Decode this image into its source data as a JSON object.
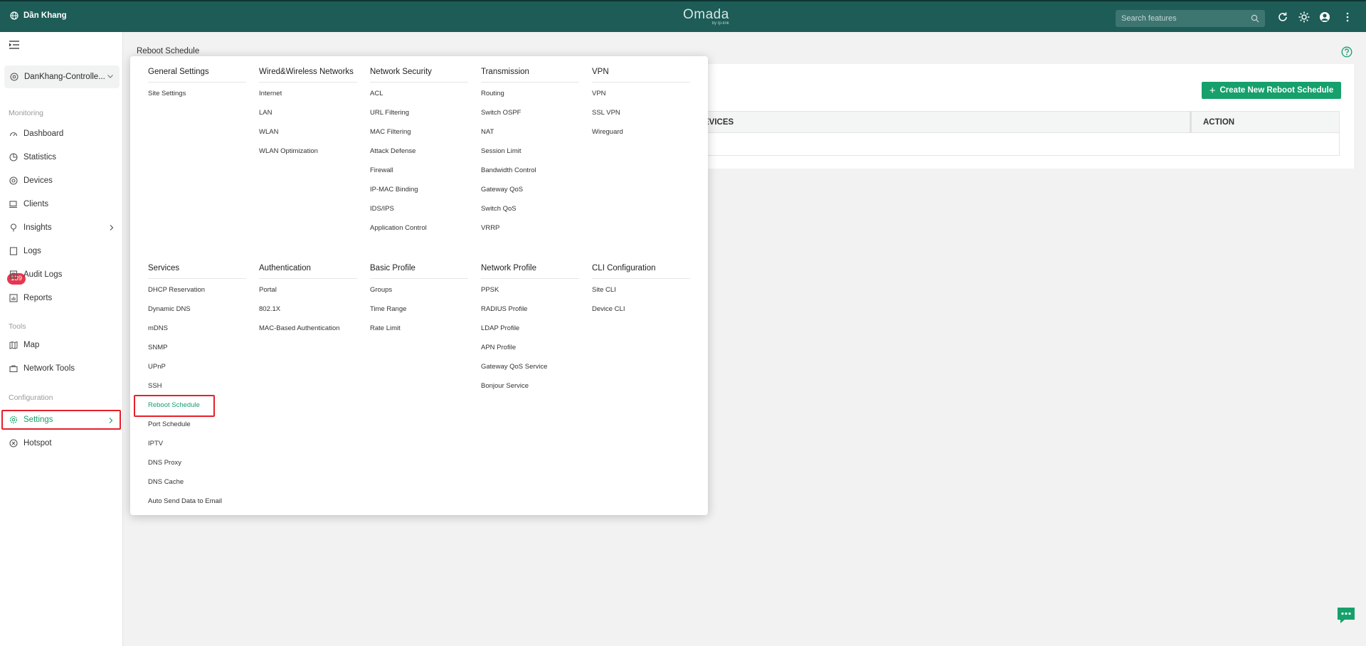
{
  "topbar": {
    "site_name": "Dần Khang",
    "logo_text": "Omada",
    "logo_sub": "by tp-link",
    "search_placeholder": "Search features"
  },
  "sidebar": {
    "site_select": "DanKhang-Controlle...",
    "sections": {
      "monitoring": "Monitoring",
      "tools": "Tools",
      "configuration": "Configuration"
    },
    "items": {
      "dashboard": "Dashboard",
      "statistics": "Statistics",
      "devices": "Devices",
      "clients": "Clients",
      "insights": "Insights",
      "logs": "Logs",
      "logs_badge": "139",
      "audit_logs": "Audit Logs",
      "reports": "Reports",
      "map": "Map",
      "network_tools": "Network Tools",
      "settings": "Settings",
      "hotspot": "Hotspot"
    }
  },
  "main": {
    "breadcrumb": "Reboot Schedule",
    "create_button": "Create New Reboot Schedule",
    "table_headers": [
      "EVICES",
      "ACTION"
    ]
  },
  "menu": {
    "columns_top": [
      {
        "title": "General Settings",
        "items": [
          "Site Settings"
        ]
      },
      {
        "title": "Wired&Wireless Networks",
        "items": [
          "Internet",
          "LAN",
          "WLAN",
          "WLAN Optimization"
        ]
      },
      {
        "title": "Network Security",
        "items": [
          "ACL",
          "URL Filtering",
          "MAC Filtering",
          "Attack Defense",
          "Firewall",
          "IP-MAC Binding",
          "IDS/IPS",
          "Application Control"
        ]
      },
      {
        "title": "Transmission",
        "items": [
          "Routing",
          "Switch OSPF",
          "NAT",
          "Session Limit",
          "Bandwidth Control",
          "Gateway QoS",
          "Switch QoS",
          "VRRP"
        ]
      },
      {
        "title": "VPN",
        "items": [
          "VPN",
          "SSL VPN",
          "Wireguard"
        ]
      }
    ],
    "columns_bottom": [
      {
        "title": "Services",
        "items": [
          "DHCP Reservation",
          "Dynamic DNS",
          "mDNS",
          "SNMP",
          "UPnP",
          "SSH",
          "Reboot Schedule",
          "Port Schedule",
          "IPTV",
          "DNS Proxy",
          "DNS Cache",
          "Auto Send Data to Email"
        ]
      },
      {
        "title": "Authentication",
        "items": [
          "Portal",
          "802.1X",
          "MAC-Based Authentication"
        ]
      },
      {
        "title": "Basic Profile",
        "items": [
          "Groups",
          "Time Range",
          "Rate Limit"
        ]
      },
      {
        "title": "Network Profile",
        "items": [
          "PPSK",
          "RADIUS Profile",
          "LDAP Profile",
          "APN Profile",
          "Gateway QoS Service",
          "Bonjour Service"
        ]
      },
      {
        "title": "CLI Configuration",
        "items": [
          "Site CLI",
          "Device CLI"
        ]
      }
    ]
  },
  "colors": {
    "topbar": "#1d5c57",
    "accent": "#16a06b",
    "highlight_box": "#e5202a",
    "badge": "#e7374e"
  }
}
